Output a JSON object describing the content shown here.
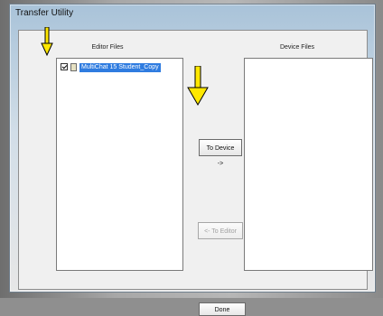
{
  "window": {
    "title": "Transfer Utility"
  },
  "editor": {
    "label": "Editor Files",
    "items": [
      {
        "label": "MultiChat 15 Student_Copy"
      }
    ]
  },
  "device": {
    "label": "Device Files"
  },
  "buttons": {
    "to_device": "To Device ->",
    "to_editor": "<- To Editor",
    "done": "Done"
  },
  "colors": {
    "selection": "#2f7ce0",
    "annotation": "#ffe800"
  }
}
